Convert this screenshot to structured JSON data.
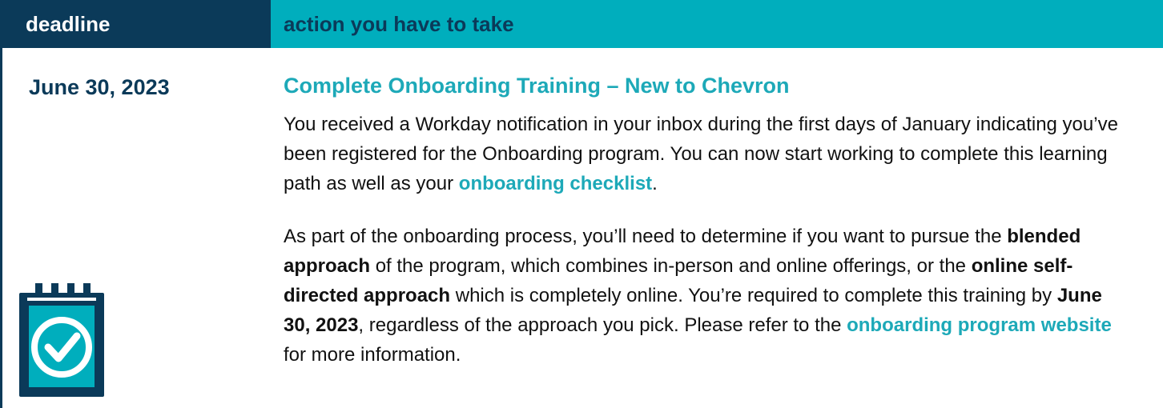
{
  "header": {
    "deadline_label": "deadline",
    "action_label": "action you have to take"
  },
  "row": {
    "deadline": "June 30, 2023",
    "title": "Complete Onboarding Training – New to Chevron",
    "paragraph1": {
      "text_before_link": "You received a Workday notification in your inbox during the first days of January indicating you’ve been registered for the Onboarding program. You can now start working to complete this learning path as well as your ",
      "link": "onboarding checklist",
      "text_after_link": "."
    },
    "paragraph2": {
      "part1": "As part of the onboarding process, you’ll need to determine if you want to pursue the ",
      "bold1": "blended approach",
      "part2": " of the program, which combines in-person and online offerings, or the ",
      "bold2": "online self-directed approach",
      "part3": " which is completely online. You’re required to complete this training by ",
      "bold3": "June 30, 2023",
      "part4": ", regardless of the approach you pick. Please refer to the ",
      "link": "onboarding program website",
      "part5": " for more information."
    }
  },
  "icon": {
    "name": "calendar-check-icon"
  },
  "colors": {
    "navy": "#0b3a59",
    "teal": "#00aebd",
    "link_teal": "#1da9b8"
  }
}
